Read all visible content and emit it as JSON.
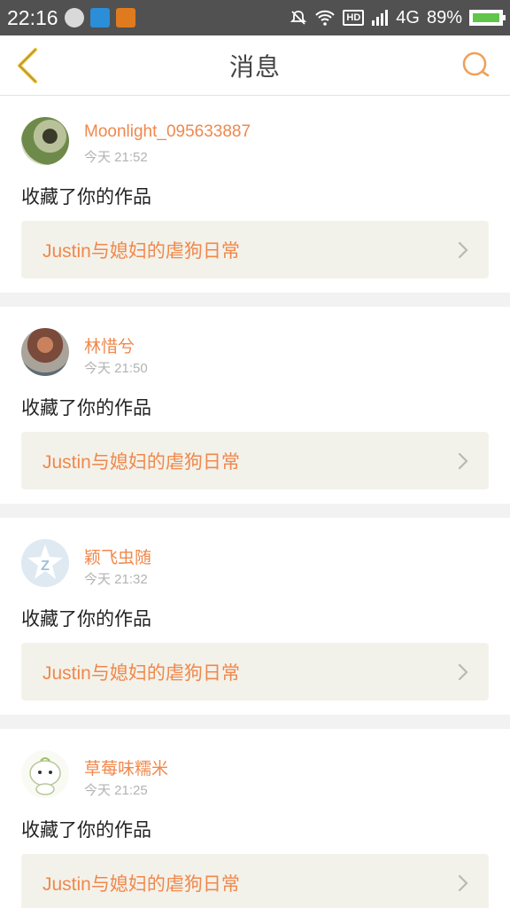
{
  "status_bar": {
    "time": "22:16",
    "network": "4G",
    "hd": "HD",
    "battery": "89%"
  },
  "header": {
    "title": "消息"
  },
  "messages": [
    {
      "username": "Moonlight_095633887",
      "time": "今天 21:52",
      "action": "收藏了你的作品",
      "work_title": "Justin与媳妇的虐狗日常"
    },
    {
      "username": "林惜兮",
      "time": "今天 21:50",
      "action": "收藏了你的作品",
      "work_title": "Justin与媳妇的虐狗日常"
    },
    {
      "username": "颖飞虫随",
      "time": "今天 21:32",
      "action": "收藏了你的作品",
      "work_title": "Justin与媳妇的虐狗日常"
    },
    {
      "username": "草莓味糯米",
      "time": "今天 21:25",
      "action": "收藏了你的作品",
      "work_title": "Justin与媳妇的虐狗日常"
    }
  ],
  "colors": {
    "accent": "#f0884c",
    "status_bar": "#515151",
    "card_link_bg": "#f3f2ea"
  }
}
